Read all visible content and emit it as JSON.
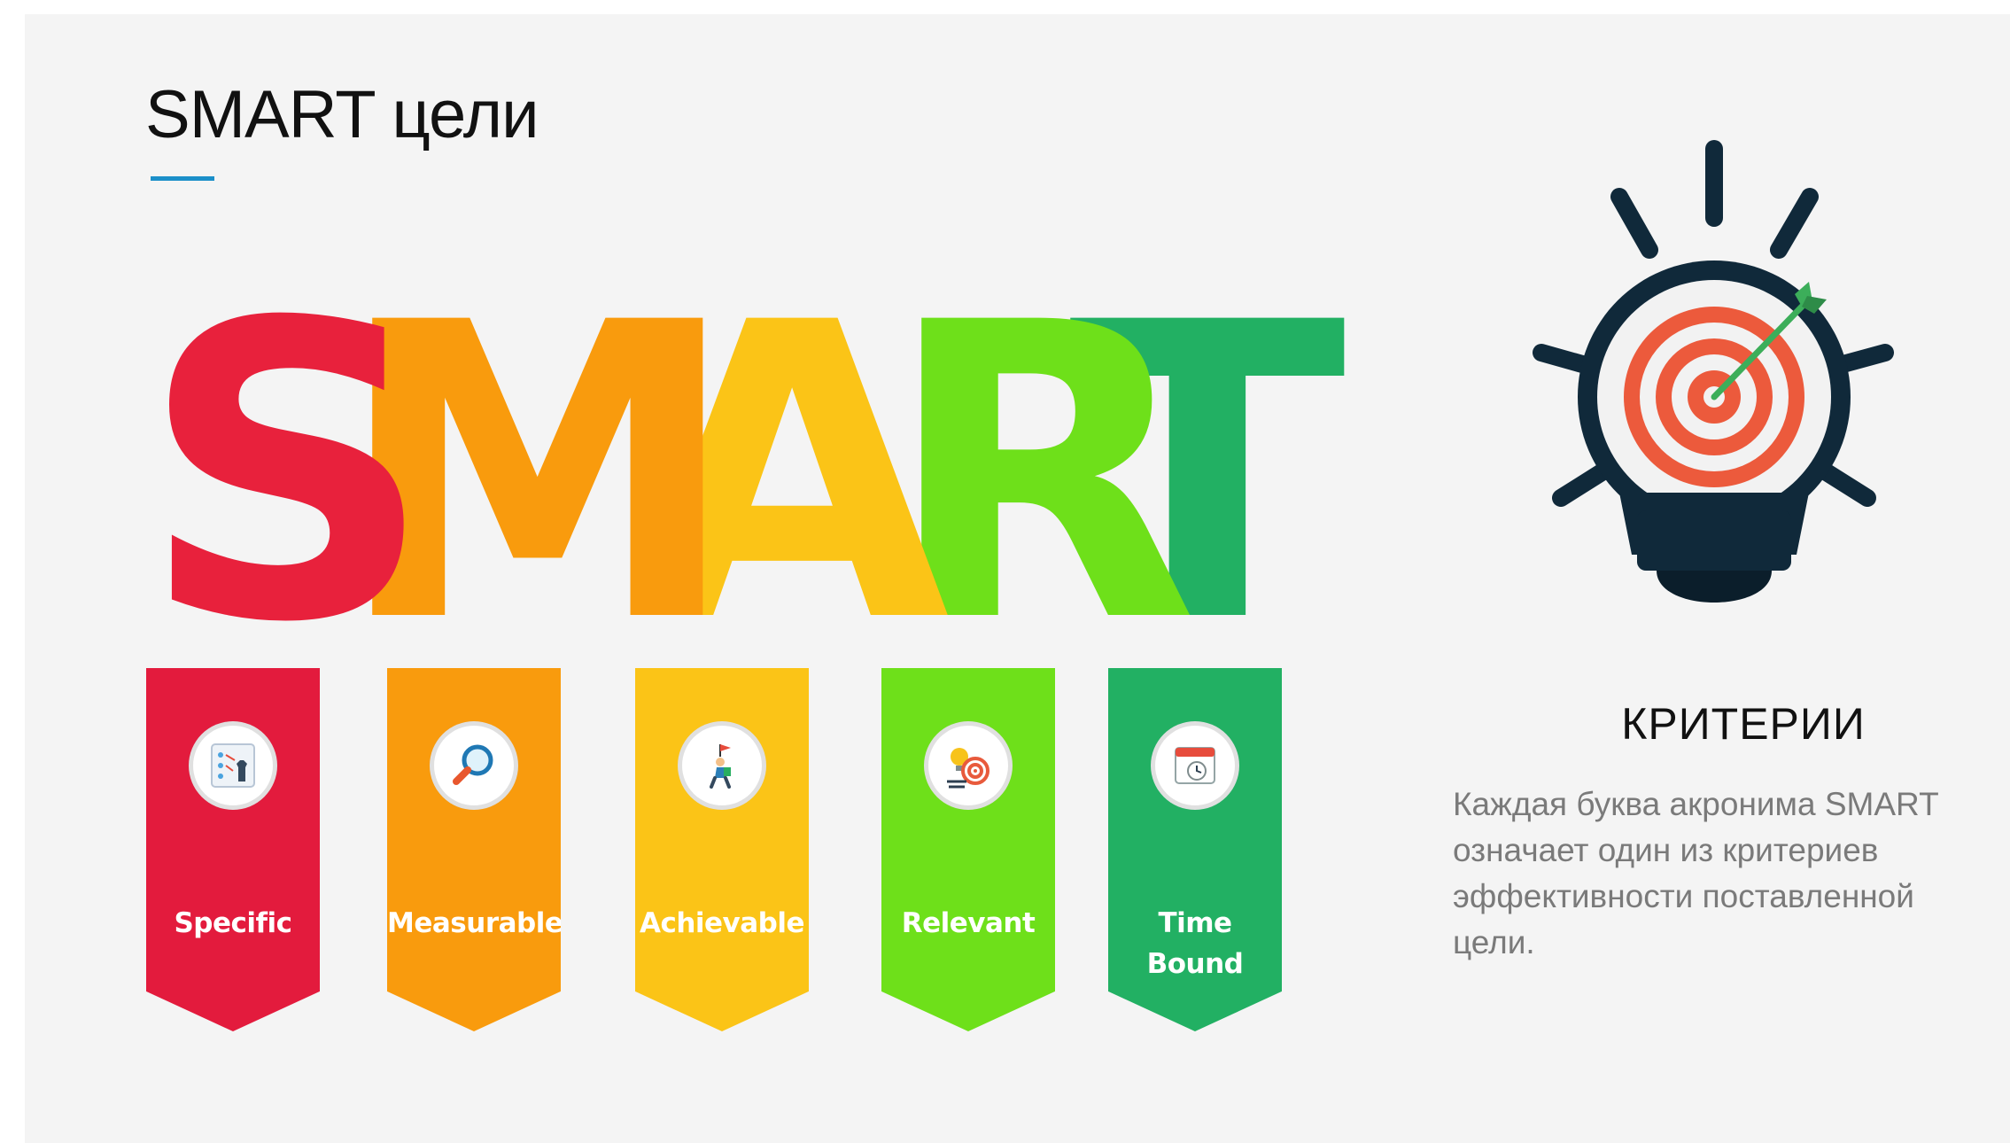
{
  "slide": {
    "title": "SMART цели",
    "accent_color": "#1b8fc9"
  },
  "smart_word": {
    "letters": [
      {
        "char": "S",
        "color": "#e8213c"
      },
      {
        "char": "M",
        "color": "#f99b0d"
      },
      {
        "char": "A",
        "color": "#fbc417"
      },
      {
        "char": "R",
        "color": "#6ee01a"
      },
      {
        "char": "T",
        "color": "#22b063"
      }
    ]
  },
  "ribbons": [
    {
      "label": "Specific",
      "color": "#e31b3d",
      "icon": "strategy-board-icon"
    },
    {
      "label": "Measurable",
      "color": "#f99b0d",
      "icon": "magnifier-icon"
    },
    {
      "label": "Achievable",
      "color": "#fbc417",
      "icon": "climber-flag-icon"
    },
    {
      "label": "Relevant",
      "color": "#6ee01a",
      "icon": "lightbulb-target-icon"
    },
    {
      "label": "Time Bound",
      "label_line1": "Time",
      "label_line2": "Bound",
      "color": "#22b063",
      "icon": "calendar-clock-icon"
    }
  ],
  "bulb": {
    "icon": "lightbulb-target-icon",
    "dark_color": "#10293a",
    "target_color": "#ec5a3c",
    "arrow_color": "#3cae5a"
  },
  "criteria": {
    "heading": "КРИТЕРИИ",
    "text": "Каждая буква акронима SMART означает один из критериев эффективности поставленной цели."
  }
}
